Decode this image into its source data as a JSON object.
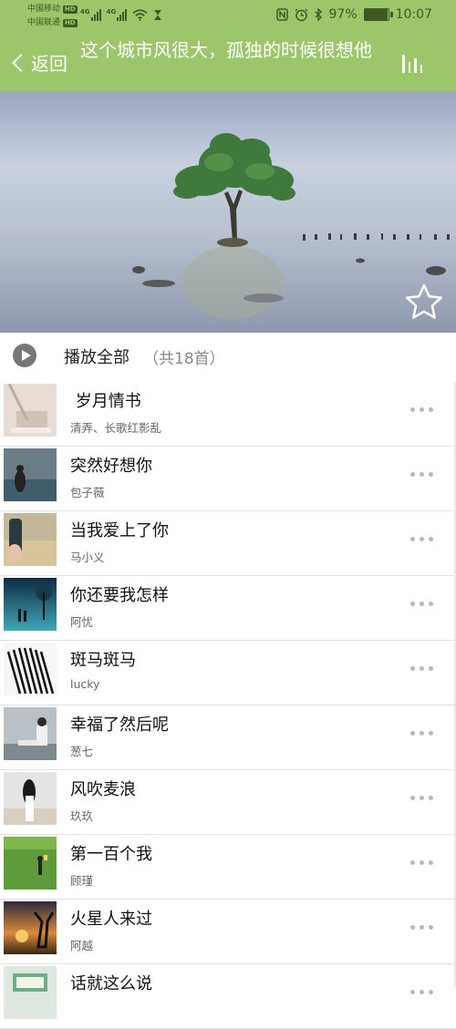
{
  "status_bar": {
    "carrier1": "中国移动",
    "carrier2": "中国联通",
    "hd": "HD",
    "net1": "4G",
    "net2": "4G",
    "battery_percent": "97%",
    "battery_level": 0.97,
    "time": "10:07",
    "icons": [
      "nfc-icon",
      "alarm-icon",
      "bluetooth-icon",
      "wifi-icon",
      "hourglass-icon"
    ]
  },
  "header": {
    "back_label": "返回",
    "title": "这个城市风很大，孤独的时候很想他",
    "right_icon": "chart-bars-icon"
  },
  "colors": {
    "accent_green": "#9bc76a",
    "status_text": "#3c5a22"
  },
  "play_all": {
    "label": "播放全部",
    "count": "（共18首）"
  },
  "songs": [
    {
      "title": " 岁月情书",
      "artist": "清弄、长歌红影乱"
    },
    {
      "title": "突然好想你",
      "artist": "包子薇"
    },
    {
      "title": "当我爱上了你",
      "artist": "马小义"
    },
    {
      "title": "你还要我怎样",
      "artist": "阿忧"
    },
    {
      "title": "斑马斑马",
      "artist": "lucky"
    },
    {
      "title": "幸福了然后呢",
      "artist": "葱七"
    },
    {
      "title": "风吹麦浪",
      "artist": "玖玖"
    },
    {
      "title": "第一百个我",
      "artist": "顾瑾"
    },
    {
      "title": "火星人来过",
      "artist": "阿越"
    },
    {
      "title": "话就这么说",
      "artist": ""
    }
  ]
}
